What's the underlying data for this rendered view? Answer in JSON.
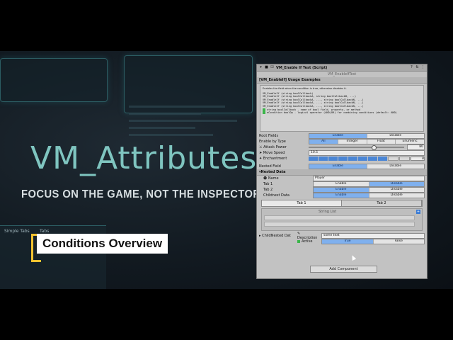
{
  "video": {
    "title": "VM_Attributes",
    "subtitle": "FOCUS ON THE GAME, NOT THE INSPECTOR",
    "chapter_label": "Conditions Overview",
    "accent": "#f2c230",
    "title_color": "#7fc5c0"
  },
  "inspector": {
    "script_title": "VM_Enable If Test (Script)",
    "script_field": "VM_EnableIfTest",
    "section_usage": "[VM_EnableIf] Usage Examples",
    "help_intro": "Enables the field when the condition is true, otherwise disables it.",
    "help_lines": [
      "VM_EnableIf (string boolCallback)",
      "VM_EnableIf (string boolCallbackA, string boolCallbackB, ...)",
      "VM_EnableIf (string boolCallbackA, ..., string boolCallbackN, ...)",
      "VM_EnableIf (string boolCallbackA, ..., string boolCallbackN, ...)",
      "VM_EnableIf (string boolCallbackA, ..., string boolCallbackN, ...)",
      "string boolCallback - name of bool field, property, or method",
      "eCondition boolOp - logical operator (AND/OR) for combining conditions (default: AND)"
    ],
    "rows": {
      "root_fields": {
        "label": "Root Fields",
        "options": [
          "Enable",
          "Disable"
        ],
        "selected": 0
      },
      "enable_by_type": {
        "label": "Enable by Type",
        "options": [
          "All",
          "Integer",
          "Float",
          "Enumeric"
        ],
        "selected": 0
      },
      "attack_power": {
        "label": "Attack Power",
        "value": "80",
        "fill": 0.66
      },
      "move_speed": {
        "label": "Move Speed",
        "value": "10.5"
      },
      "enchantment": {
        "label": "Enchantment",
        "value": "8",
        "level": 8,
        "max": 10
      },
      "nested_field": {
        "label": "Nested Field",
        "options": [
          "Enable",
          "Disable"
        ],
        "selected": 0
      }
    },
    "nested": {
      "header": "Nested Data",
      "name_label": "Name",
      "name_value": "Player",
      "tab1": {
        "label": "Tab 1",
        "options": [
          "Enable",
          "Disable"
        ],
        "selected": 1
      },
      "tab2": {
        "label": "Tab 2",
        "options": [
          "Enable",
          "Disable"
        ],
        "selected": 0
      },
      "child_nested": {
        "label": "Childnest Data",
        "options": [
          "Enable",
          "Disable"
        ],
        "selected": 0
      },
      "tabs": [
        "Tab 1",
        "Tab 2"
      ],
      "list_title": "String List",
      "child_nested_data": "ChildNested Dat",
      "description_label": "Description",
      "description_value": "some text",
      "active_label": "Active",
      "active_options": [
        "True",
        "False"
      ],
      "active_selected": 0
    },
    "add_component": "Add Component"
  }
}
